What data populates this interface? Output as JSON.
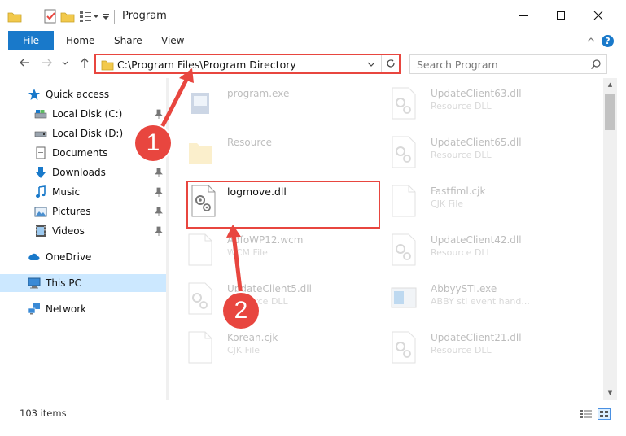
{
  "window": {
    "title": "Program"
  },
  "ribbon": {
    "file": "File",
    "home": "Home",
    "share": "Share",
    "view": "View",
    "help": "?"
  },
  "address": {
    "path": "C:\\Program Files\\Program Directory",
    "search_placeholder": "Search Program"
  },
  "nav": {
    "quick_access": "Quick access",
    "items": [
      {
        "label": "Local Disk (C:)",
        "icon": "drive-icon",
        "pinned": true
      },
      {
        "label": "Local Disk (D:)",
        "icon": "drive-icon",
        "pinned": false
      },
      {
        "label": "Documents",
        "icon": "documents-icon",
        "pinned": true
      },
      {
        "label": "Downloads",
        "icon": "downloads-icon",
        "pinned": true
      },
      {
        "label": "Music",
        "icon": "music-icon",
        "pinned": true
      },
      {
        "label": "Pictures",
        "icon": "pictures-icon",
        "pinned": true
      },
      {
        "label": "Videos",
        "icon": "videos-icon",
        "pinned": true
      }
    ],
    "onedrive": "OneDrive",
    "this_pc": "This PC",
    "network": "Network"
  },
  "files": {
    "col1": [
      {
        "name": "program.exe",
        "type": ""
      },
      {
        "name": "Resource",
        "type": ""
      },
      {
        "name": "logmove.dll",
        "type": ""
      },
      {
        "name": "AdfoWP12.wcm",
        "type": "WCM File"
      },
      {
        "name": "UpdateClient5.dll",
        "type": "Resource DLL"
      },
      {
        "name": "Korean.cjk",
        "type": "CJK File"
      }
    ],
    "col2": [
      {
        "name": "UpdateClient63.dll",
        "type": "Resource DLL"
      },
      {
        "name": "UpdateClient65.dll",
        "type": "Resource DLL"
      },
      {
        "name": "Fastfiml.cjk",
        "type": "CJK File"
      },
      {
        "name": "UpdateClient42.dll",
        "type": "Resource DLL"
      },
      {
        "name": "AbbyySTI.exe",
        "type": "ABBY sti event hand..."
      },
      {
        "name": "UpdateClient21.dll",
        "type": "Resource DLL"
      }
    ]
  },
  "annotations": {
    "step1": "1",
    "step2": "2"
  },
  "status": {
    "count": "103 items"
  },
  "colors": {
    "accent": "#1979ca",
    "annotation_red": "#e8463f",
    "selection": "#cce8ff"
  }
}
